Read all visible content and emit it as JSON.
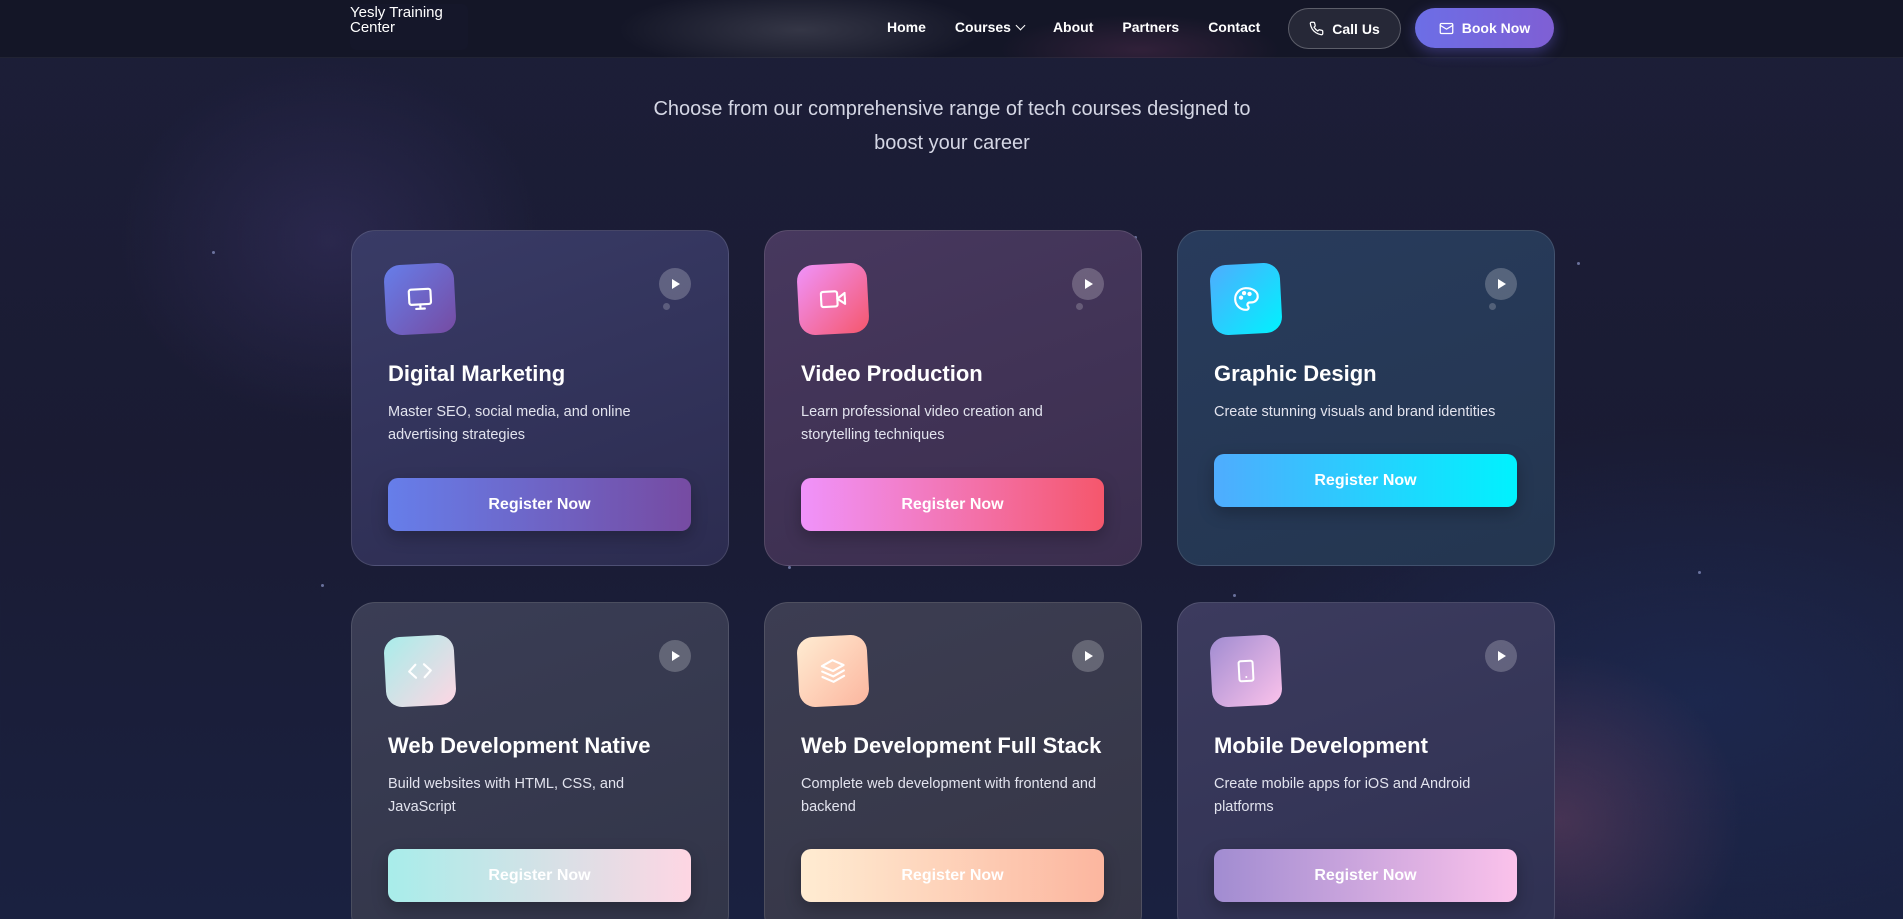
{
  "nav": {
    "logo_alt": "Yesly Training Center",
    "links": [
      "Home",
      "Courses",
      "About",
      "Partners",
      "Contact"
    ],
    "call_label": "Call Us",
    "book_label": "Book Now"
  },
  "section": {
    "subtitle_line1": "Choose from our comprehensive range of tech courses designed to",
    "subtitle_line2": "boost your career"
  },
  "courses": [
    {
      "title": "Digital Marketing",
      "description": "Master SEO, social media, and online advertising strategies",
      "button": "Register Now",
      "icon": "monitor-icon",
      "color_from": "#667eea",
      "color_to": "#764ba2"
    },
    {
      "title": "Video Production",
      "description": "Learn professional video creation and storytelling techniques",
      "button": "Register Now",
      "icon": "video-icon",
      "color_from": "#f093fb",
      "color_to": "#f5576c"
    },
    {
      "title": "Graphic Design",
      "description": "Create stunning visuals and brand identities",
      "button": "Register Now",
      "icon": "palette-icon",
      "color_from": "#4facfe",
      "color_to": "#00f2fe"
    },
    {
      "title": "Web Development Native",
      "description": "Build websites with HTML, CSS, and JavaScript",
      "button": "Register Now",
      "icon": "code-icon",
      "color_from": "#a8edea",
      "color_to": "#fed6e3"
    },
    {
      "title": "Web Development Full Stack",
      "description": "Complete web development with frontend and backend",
      "button": "Register Now",
      "icon": "layers-icon",
      "color_from": "#ffecd2",
      "color_to": "#fcb69f"
    },
    {
      "title": "Mobile Development",
      "description": "Create mobile apps for iOS and Android platforms",
      "button": "Register Now",
      "icon": "smartphone-icon",
      "color_from": "#a18cd1",
      "color_to": "#fbc2eb"
    }
  ]
}
